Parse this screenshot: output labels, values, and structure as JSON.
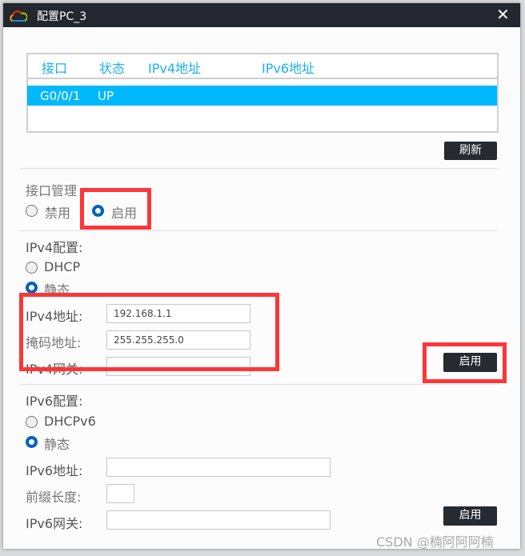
{
  "window": {
    "title": "配置PC_3",
    "close_icon": "close-icon",
    "logo": "cloud-logo-icon"
  },
  "interface_table": {
    "headers": [
      "接口",
      "状态",
      "IPv4地址",
      "IPv6地址"
    ],
    "rows": [
      {
        "interface": "G0/0/1",
        "status": "UP",
        "ipv4": "",
        "ipv6": ""
      }
    ],
    "selected_color": "#00b8fe"
  },
  "refresh_label": "刷新",
  "interface_mgmt": {
    "label": "接口管理",
    "options": [
      "禁用",
      "启用"
    ],
    "selected": "启用"
  },
  "ipv4": {
    "section": "IPv4配置:",
    "options": [
      "DHCP",
      "静态"
    ],
    "selected": "静态",
    "address_label": "IPv4地址:",
    "address": "192.168.1.1",
    "mask_label": "掩码地址:",
    "mask": "255.255.255.0",
    "gateway_label": "IPv4网关:",
    "gateway": "",
    "apply_label": "启用"
  },
  "ipv6": {
    "section": "IPv6配置:",
    "options": [
      "DHCPv6",
      "静态"
    ],
    "selected": "静态",
    "address_label": "IPv6地址:",
    "address": "",
    "prefix_label": "前缀长度:",
    "prefix": "",
    "gateway_label": "IPv6网关:",
    "gateway": "",
    "apply_label": "启用"
  },
  "watermark": "CSDN @楠阿阿阿楠",
  "highlight_color": "#fc3638"
}
